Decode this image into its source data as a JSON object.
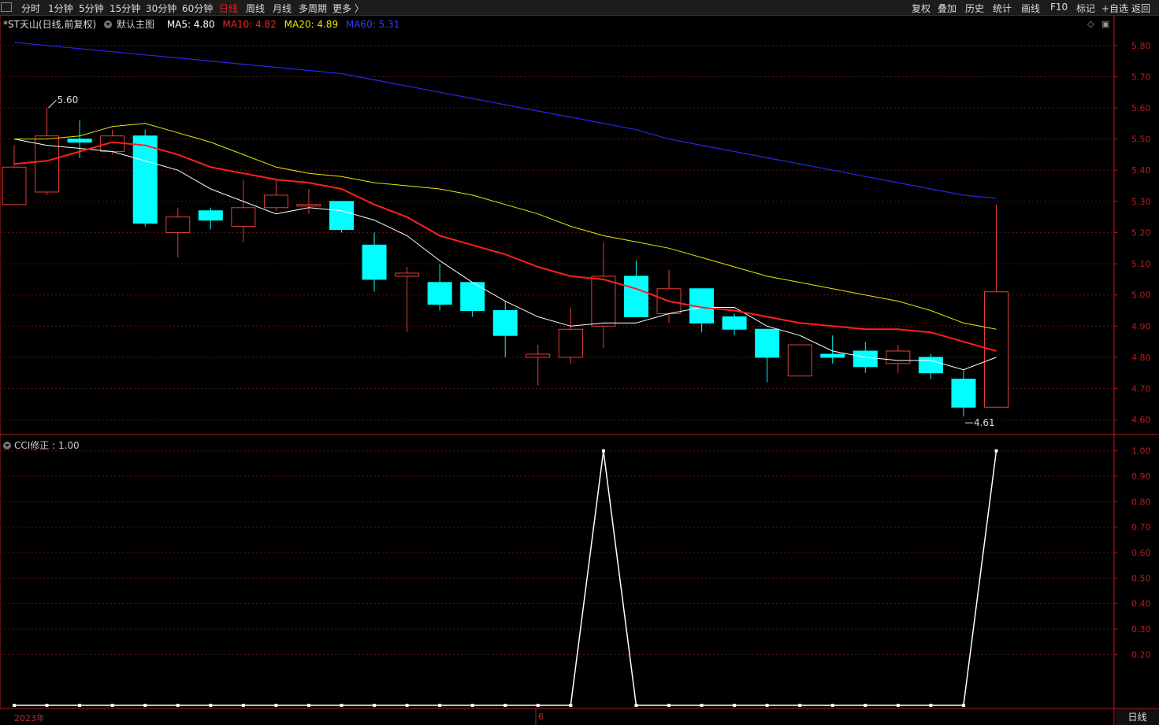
{
  "toolbar": {
    "periods": [
      "分时",
      "1分钟",
      "5分钟",
      "15分钟",
      "30分钟",
      "60分钟",
      "日线",
      "周线",
      "月线",
      "多周期",
      "更多 〉"
    ],
    "active_period": "日线",
    "right_buttons": [
      "复权",
      "叠加",
      "历史",
      "统计",
      "画线",
      "F10",
      "标记",
      "+自选",
      "返回"
    ]
  },
  "legend": {
    "stock": "*ST天山(日线,前复权)",
    "indicator": "默认主图",
    "ma5": "MA5: 4.80",
    "ma10": "MA10: 4.82",
    "ma20": "MA20: 4.89",
    "ma60": "MA60: 5.31"
  },
  "cci_legend": "CCI修正 : 1.00",
  "x_labels": [
    "2023年",
    "6"
  ],
  "period_box": "日线",
  "colors": {
    "up": "#e0413a",
    "down": "#00ffff",
    "ma5": "#ffffff",
    "ma10": "#ff2020",
    "ma20": "#e8e800",
    "ma60": "#2828e8",
    "grid": "#5a1414",
    "axis": "#b02020"
  },
  "chart_data": [
    {
      "type": "candlestick",
      "title": "",
      "ylim": [
        4.57,
        5.85
      ],
      "yticks": [
        "5.80",
        "5.70",
        "5.60",
        "5.50",
        "5.40",
        "5.30",
        "5.20",
        "5.10",
        "5.00",
        "4.90",
        "4.80",
        "4.70",
        "4.60"
      ],
      "annotations": [
        {
          "text": "5.60",
          "index": 1,
          "value": 5.6
        },
        {
          "text": "4.61",
          "index": 29,
          "value": 4.61
        }
      ],
      "candles": [
        {
          "open": 5.29,
          "close": 5.41,
          "high": 5.48,
          "low": 5.29
        },
        {
          "open": 5.33,
          "close": 5.51,
          "high": 5.6,
          "low": 5.32
        },
        {
          "open": 5.5,
          "close": 5.49,
          "high": 5.56,
          "low": 5.44
        },
        {
          "open": 5.46,
          "close": 5.51,
          "high": 5.53,
          "low": 5.45
        },
        {
          "open": 5.51,
          "close": 5.23,
          "high": 5.53,
          "low": 5.22
        },
        {
          "open": 5.2,
          "close": 5.25,
          "high": 5.28,
          "low": 5.12
        },
        {
          "open": 5.27,
          "close": 5.24,
          "high": 5.28,
          "low": 5.21
        },
        {
          "open": 5.22,
          "close": 5.28,
          "high": 5.37,
          "low": 5.17
        },
        {
          "open": 5.28,
          "close": 5.32,
          "high": 5.37,
          "low": 5.27
        },
        {
          "open": 5.29,
          "close": 5.29,
          "high": 5.34,
          "low": 5.26
        },
        {
          "open": 5.3,
          "close": 5.21,
          "high": 5.3,
          "low": 5.2
        },
        {
          "open": 5.16,
          "close": 5.05,
          "high": 5.2,
          "low": 5.01
        },
        {
          "open": 5.06,
          "close": 5.07,
          "high": 5.09,
          "low": 4.88
        },
        {
          "open": 5.04,
          "close": 4.97,
          "high": 5.1,
          "low": 4.95
        },
        {
          "open": 5.04,
          "close": 4.95,
          "high": 5.04,
          "low": 4.93
        },
        {
          "open": 4.95,
          "close": 4.87,
          "high": 4.98,
          "low": 4.8
        },
        {
          "open": 4.8,
          "close": 4.81,
          "high": 4.84,
          "low": 4.71
        },
        {
          "open": 4.8,
          "close": 4.89,
          "high": 4.96,
          "low": 4.78
        },
        {
          "open": 4.9,
          "close": 5.06,
          "high": 5.17,
          "low": 4.83
        },
        {
          "open": 5.06,
          "close": 4.93,
          "high": 5.11,
          "low": 4.93
        },
        {
          "open": 4.94,
          "close": 5.02,
          "high": 5.08,
          "low": 4.91
        },
        {
          "open": 5.02,
          "close": 4.91,
          "high": 5.02,
          "low": 4.88
        },
        {
          "open": 4.93,
          "close": 4.89,
          "high": 4.94,
          "low": 4.87
        },
        {
          "open": 4.89,
          "close": 4.8,
          "high": 4.89,
          "low": 4.72
        },
        {
          "open": 4.74,
          "close": 4.84,
          "high": 4.84,
          "low": 4.74
        },
        {
          "open": 4.81,
          "close": 4.8,
          "high": 4.87,
          "low": 4.78
        },
        {
          "open": 4.82,
          "close": 4.77,
          "high": 4.85,
          "low": 4.75
        },
        {
          "open": 4.78,
          "close": 4.82,
          "high": 4.84,
          "low": 4.75
        },
        {
          "open": 4.8,
          "close": 4.75,
          "high": 4.81,
          "low": 4.73
        },
        {
          "open": 4.73,
          "close": 4.64,
          "high": 4.76,
          "low": 4.61
        },
        {
          "open": 4.64,
          "close": 5.01,
          "high": 5.29,
          "low": 4.64
        }
      ],
      "series": [
        {
          "name": "MA5",
          "values": [
            5.5,
            5.48,
            5.47,
            5.46,
            5.43,
            5.4,
            5.34,
            5.3,
            5.26,
            5.28,
            5.27,
            5.24,
            5.19,
            5.11,
            5.04,
            4.98,
            4.93,
            4.9,
            4.91,
            4.91,
            4.94,
            4.96,
            4.96,
            4.9,
            4.87,
            4.82,
            4.8,
            4.79,
            4.79,
            4.76,
            4.8
          ]
        },
        {
          "name": "MA10",
          "values": [
            5.42,
            5.43,
            5.46,
            5.49,
            5.48,
            5.45,
            5.41,
            5.39,
            5.37,
            5.36,
            5.34,
            5.29,
            5.25,
            5.19,
            5.16,
            5.13,
            5.09,
            5.06,
            5.05,
            5.02,
            4.98,
            4.96,
            4.95,
            4.93,
            4.91,
            4.9,
            4.89,
            4.89,
            4.88,
            4.85,
            4.82
          ]
        },
        {
          "name": "MA20",
          "values": [
            5.5,
            5.5,
            5.51,
            5.54,
            5.55,
            5.52,
            5.49,
            5.45,
            5.41,
            5.39,
            5.38,
            5.36,
            5.35,
            5.34,
            5.32,
            5.29,
            5.26,
            5.22,
            5.19,
            5.17,
            5.15,
            5.12,
            5.09,
            5.06,
            5.04,
            5.02,
            5.0,
            4.98,
            4.95,
            4.91,
            4.89
          ]
        },
        {
          "name": "MA60",
          "values": [
            5.81,
            5.8,
            5.79,
            5.78,
            5.77,
            5.76,
            5.75,
            5.74,
            5.73,
            5.72,
            5.71,
            5.69,
            5.67,
            5.65,
            5.63,
            5.61,
            5.59,
            5.57,
            5.55,
            5.53,
            5.5,
            5.48,
            5.46,
            5.44,
            5.42,
            5.4,
            5.38,
            5.36,
            5.34,
            5.32,
            5.31
          ]
        }
      ]
    },
    {
      "type": "line",
      "title": "",
      "ylim": [
        0.0,
        1.03
      ],
      "yticks": [
        "1.00",
        "0.90",
        "0.80",
        "0.70",
        "0.60",
        "0.50",
        "0.40",
        "0.30",
        "0.20"
      ],
      "series": [
        {
          "name": "CCI修正",
          "values": [
            0,
            0,
            0,
            0,
            0,
            0,
            0,
            0,
            0,
            0,
            0,
            0,
            0,
            0,
            0,
            0,
            0,
            0,
            1,
            0,
            0,
            0,
            0,
            0,
            0,
            0,
            0,
            0,
            0,
            0,
            1
          ]
        }
      ]
    }
  ]
}
